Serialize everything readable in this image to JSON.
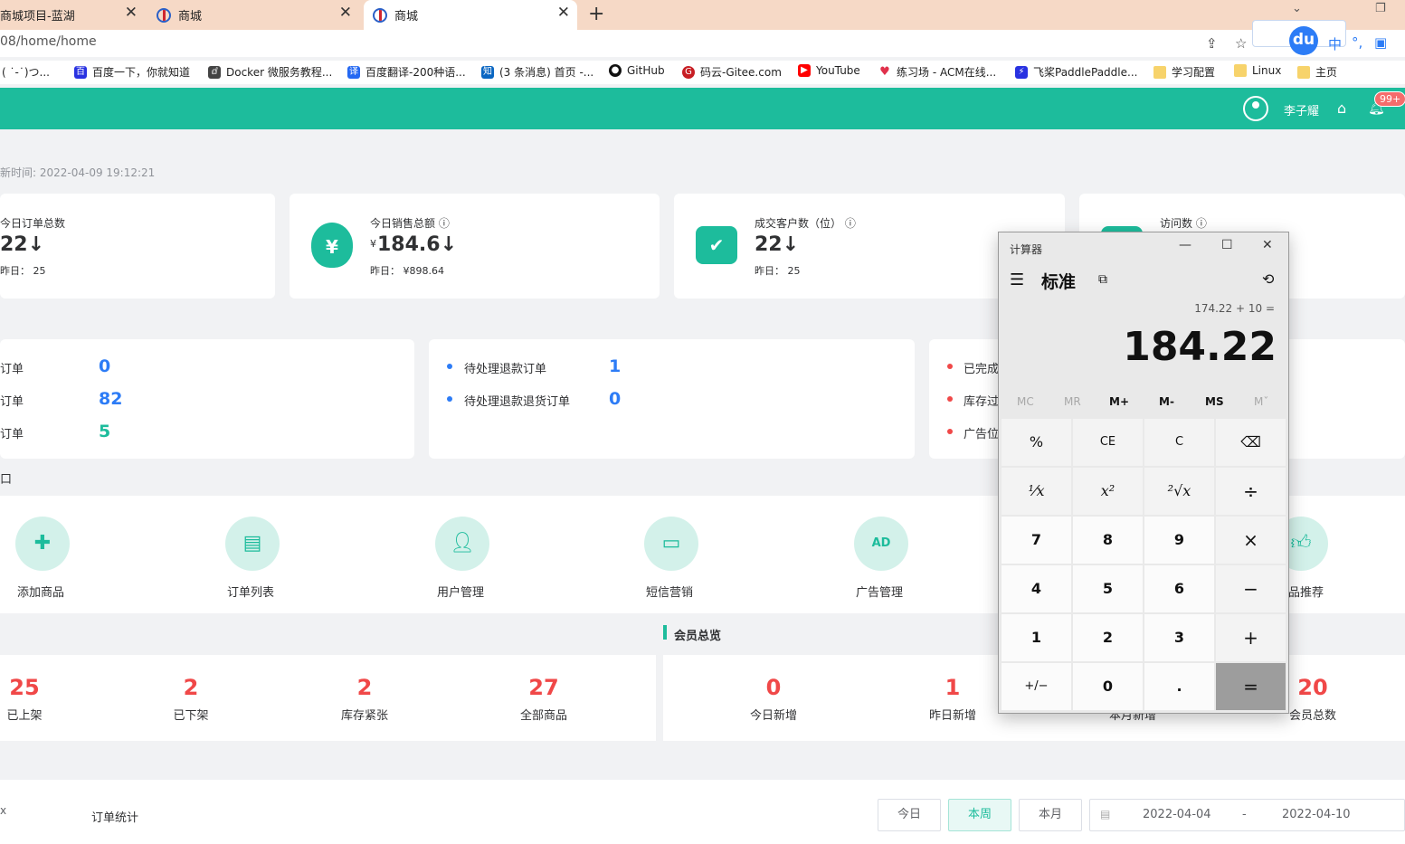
{
  "browser": {
    "tabs": [
      {
        "title": "商城项目-蓝湖"
      },
      {
        "title": "商城"
      },
      {
        "title": "商城"
      }
    ],
    "new_tab": "+",
    "url": "08/home/home",
    "ime": {
      "du": "du",
      "lang": "中"
    },
    "bookmarks": [
      {
        "label": "( ˙-˙)つ..."
      },
      {
        "label": "百度一下，你就知道"
      },
      {
        "label": "Docker 微服务教程..."
      },
      {
        "label": "百度翻译-200种语..."
      },
      {
        "label": "(3 条消息) 首页 -..."
      },
      {
        "label": "GitHub"
      },
      {
        "label": "码云-Gitee.com"
      },
      {
        "label": "YouTube"
      },
      {
        "label": "练习场 - ACM在线..."
      },
      {
        "label": "飞桨PaddlePaddle..."
      },
      {
        "label": "学习配置"
      },
      {
        "label": "Linux"
      },
      {
        "label": "主页"
      }
    ]
  },
  "header": {
    "username": "李子耀",
    "badge": "99+",
    "accent": "#1dbc9c"
  },
  "update_time": "新时间: 2022-04-09 19:12:21",
  "stats": [
    {
      "label": "今日订单总数",
      "value": "22↓",
      "yesterday": "昨日： 25"
    },
    {
      "label": "今日销售总额 ⓘ",
      "currency": "¥",
      "value": "184.6↓",
      "yesterday": "昨日： ¥898.64"
    },
    {
      "label": "成交客户数（位） ⓘ",
      "value": "22↓",
      "yesterday": "昨日： 25"
    },
    {
      "label": "访问数 ⓘ"
    }
  ],
  "todo": {
    "left": [
      {
        "label": "订单",
        "value": "0"
      },
      {
        "label": "订单",
        "value": "82"
      },
      {
        "label": "订单",
        "value": "5"
      }
    ],
    "middle": [
      {
        "label": "待处理退款订单",
        "value": "1"
      },
      {
        "label": "待处理退款退货订单",
        "value": "0"
      }
    ],
    "right": [
      {
        "label": "已完成"
      },
      {
        "label": "库存过"
      },
      {
        "label": "广告位"
      }
    ]
  },
  "quick_title": "口",
  "quick": [
    {
      "label": "添加商品",
      "icon": "bag-plus-icon"
    },
    {
      "label": "订单列表",
      "icon": "clipboard-icon"
    },
    {
      "label": "用户管理",
      "icon": "users-icon"
    },
    {
      "label": "短信营销",
      "icon": "message-icon"
    },
    {
      "label": "广告管理",
      "icon": "ad-icon"
    },
    {
      "label": "品推荐",
      "icon": "thumbs-up-icon"
    }
  ],
  "member_title": "会员总览",
  "product_overview": [
    {
      "num": "25",
      "label": "已上架"
    },
    {
      "num": "2",
      "label": "已下架"
    },
    {
      "num": "2",
      "label": "库存紧张"
    },
    {
      "num": "27",
      "label": "全部商品"
    }
  ],
  "member_overview": [
    {
      "num": "0",
      "label": "今日新增"
    },
    {
      "num": "1",
      "label": "昨日新增"
    },
    {
      "num": "",
      "label": "本月新增"
    },
    {
      "num": "20",
      "label": "会员总数"
    }
  ],
  "order_stats": {
    "side": "x",
    "title": "订单统计",
    "buttons": [
      "今日",
      "本周",
      "本月"
    ],
    "start": "2022-04-04",
    "sep": "-",
    "end": "2022-04-10"
  },
  "calculator": {
    "title": "计算器",
    "mode": "标准",
    "expression": "174.22 + 10 =",
    "display": "184.22",
    "memory": [
      "MC",
      "MR",
      "M+",
      "M-",
      "MS",
      "Mˇ"
    ],
    "keys": [
      [
        "%",
        "CE",
        "C",
        "⌫"
      ],
      [
        "¹⁄x",
        "x²",
        "²√x",
        "÷"
      ],
      [
        "7",
        "8",
        "9",
        "×"
      ],
      [
        "4",
        "5",
        "6",
        "−"
      ],
      [
        "1",
        "2",
        "3",
        "+"
      ],
      [
        "+/−",
        "0",
        ".",
        "="
      ]
    ]
  }
}
